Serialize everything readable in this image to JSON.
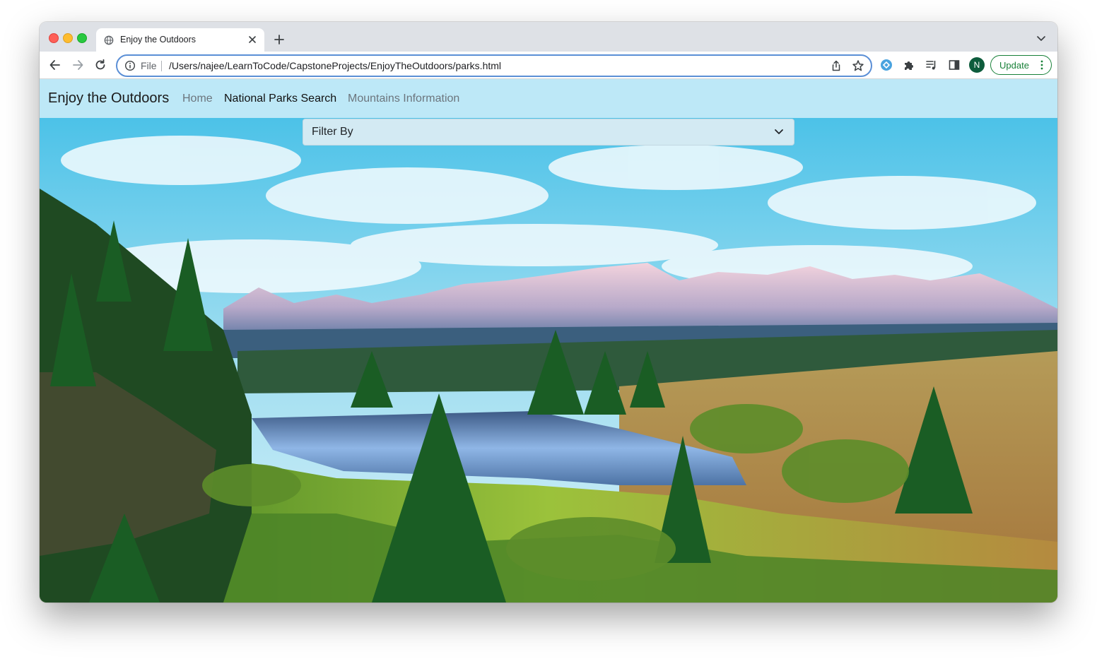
{
  "browser": {
    "tab_title": "Enjoy the Outdoors",
    "omnibox": {
      "scheme_label": "File",
      "url": "/Users/najee/LearnToCode/CapstoneProjects/EnjoyTheOutdoors/parks.html"
    },
    "profile_initial": "N",
    "update_label": "Update",
    "accent_color": "#188038",
    "omnibox_focus_color": "#5b8fd6"
  },
  "page": {
    "brand": "Enjoy the Outdoors",
    "nav": {
      "home": "Home",
      "parks": "National Parks Search",
      "mountains": "Mountains Information"
    },
    "navbar_color": "#bde8f7",
    "filter": {
      "selected": "Filter By"
    },
    "hero_image": "mountain lake landscape with pine trees"
  },
  "icons": {
    "tab_favicon": "globe-icon",
    "tab_close": "close-icon",
    "new_tab": "plus-icon",
    "tab_search": "chevron-down-icon",
    "back": "back-arrow-icon",
    "forward": "forward-arrow-icon",
    "reload": "reload-icon",
    "site_info": "info-icon",
    "share": "share-icon",
    "bookmark": "star-icon",
    "extension_1": "extension-badge-icon",
    "extensions": "puzzle-icon",
    "media": "media-playlist-icon",
    "side_panel": "side-panel-icon",
    "menu": "kebab-menu-icon",
    "select_chevron": "chevron-down-icon"
  }
}
